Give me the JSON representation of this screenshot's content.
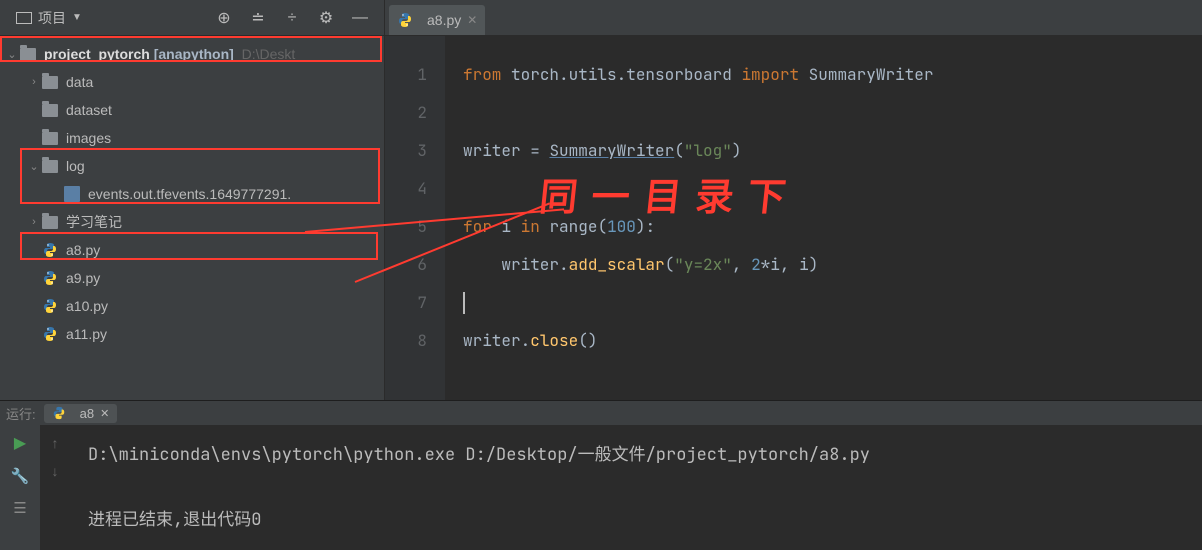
{
  "sidebar": {
    "project_label": "项目",
    "root": {
      "name": "project_pytorch",
      "env": "[anapython]",
      "path": "D:\\Deskt"
    },
    "items": [
      {
        "name": "data",
        "type": "folder",
        "level": 1,
        "expand": "closed"
      },
      {
        "name": "dataset",
        "type": "folder",
        "level": 1,
        "expand": "none"
      },
      {
        "name": "images",
        "type": "folder",
        "level": 1,
        "expand": "none"
      },
      {
        "name": "log",
        "type": "folder",
        "level": 1,
        "expand": "open"
      },
      {
        "name": "events.out.tfevents.1649777291.",
        "type": "file",
        "level": 2,
        "expand": "none"
      },
      {
        "name": "学习笔记",
        "type": "folder",
        "level": 1,
        "expand": "closed"
      },
      {
        "name": "a8.py",
        "type": "py",
        "level": 1,
        "expand": "none"
      },
      {
        "name": "a9.py",
        "type": "py",
        "level": 1,
        "expand": "none"
      },
      {
        "name": "a10.py",
        "type": "py",
        "level": 1,
        "expand": "none"
      },
      {
        "name": "a11.py",
        "type": "py",
        "level": 1,
        "expand": "none"
      }
    ]
  },
  "editor": {
    "tab": "a8.py",
    "line_numbers": [
      "1",
      "2",
      "3",
      "4",
      "5",
      "6",
      "7",
      "8"
    ],
    "code": {
      "l1": {
        "kw1": "from",
        "mod": "torch.utils.tensorboard",
        "kw2": "import",
        "name": "SummaryWriter"
      },
      "l3": {
        "var": "writer",
        "eq": "=",
        "cls": "SummaryWriter",
        "arg": "\"log\""
      },
      "l5": {
        "kw1": "for",
        "var": "i",
        "kw2": "in",
        "fn": "range",
        "arg": "100"
      },
      "l6": {
        "obj": "writer",
        "fn": "add_scalar",
        "arg1": "\"y=2x\"",
        "arg2a": "2",
        "arg2b": "i",
        "arg3": "i"
      },
      "l8": {
        "obj": "writer",
        "fn": "close"
      }
    }
  },
  "annotation": {
    "text": "同一目录下"
  },
  "run": {
    "label": "运行:",
    "tab": "a8",
    "cmd": "D:\\miniconda\\envs\\pytorch\\python.exe D:/Desktop/一般文件/project_pytorch/a8.py",
    "exit": "进程已结束,退出代码0"
  }
}
